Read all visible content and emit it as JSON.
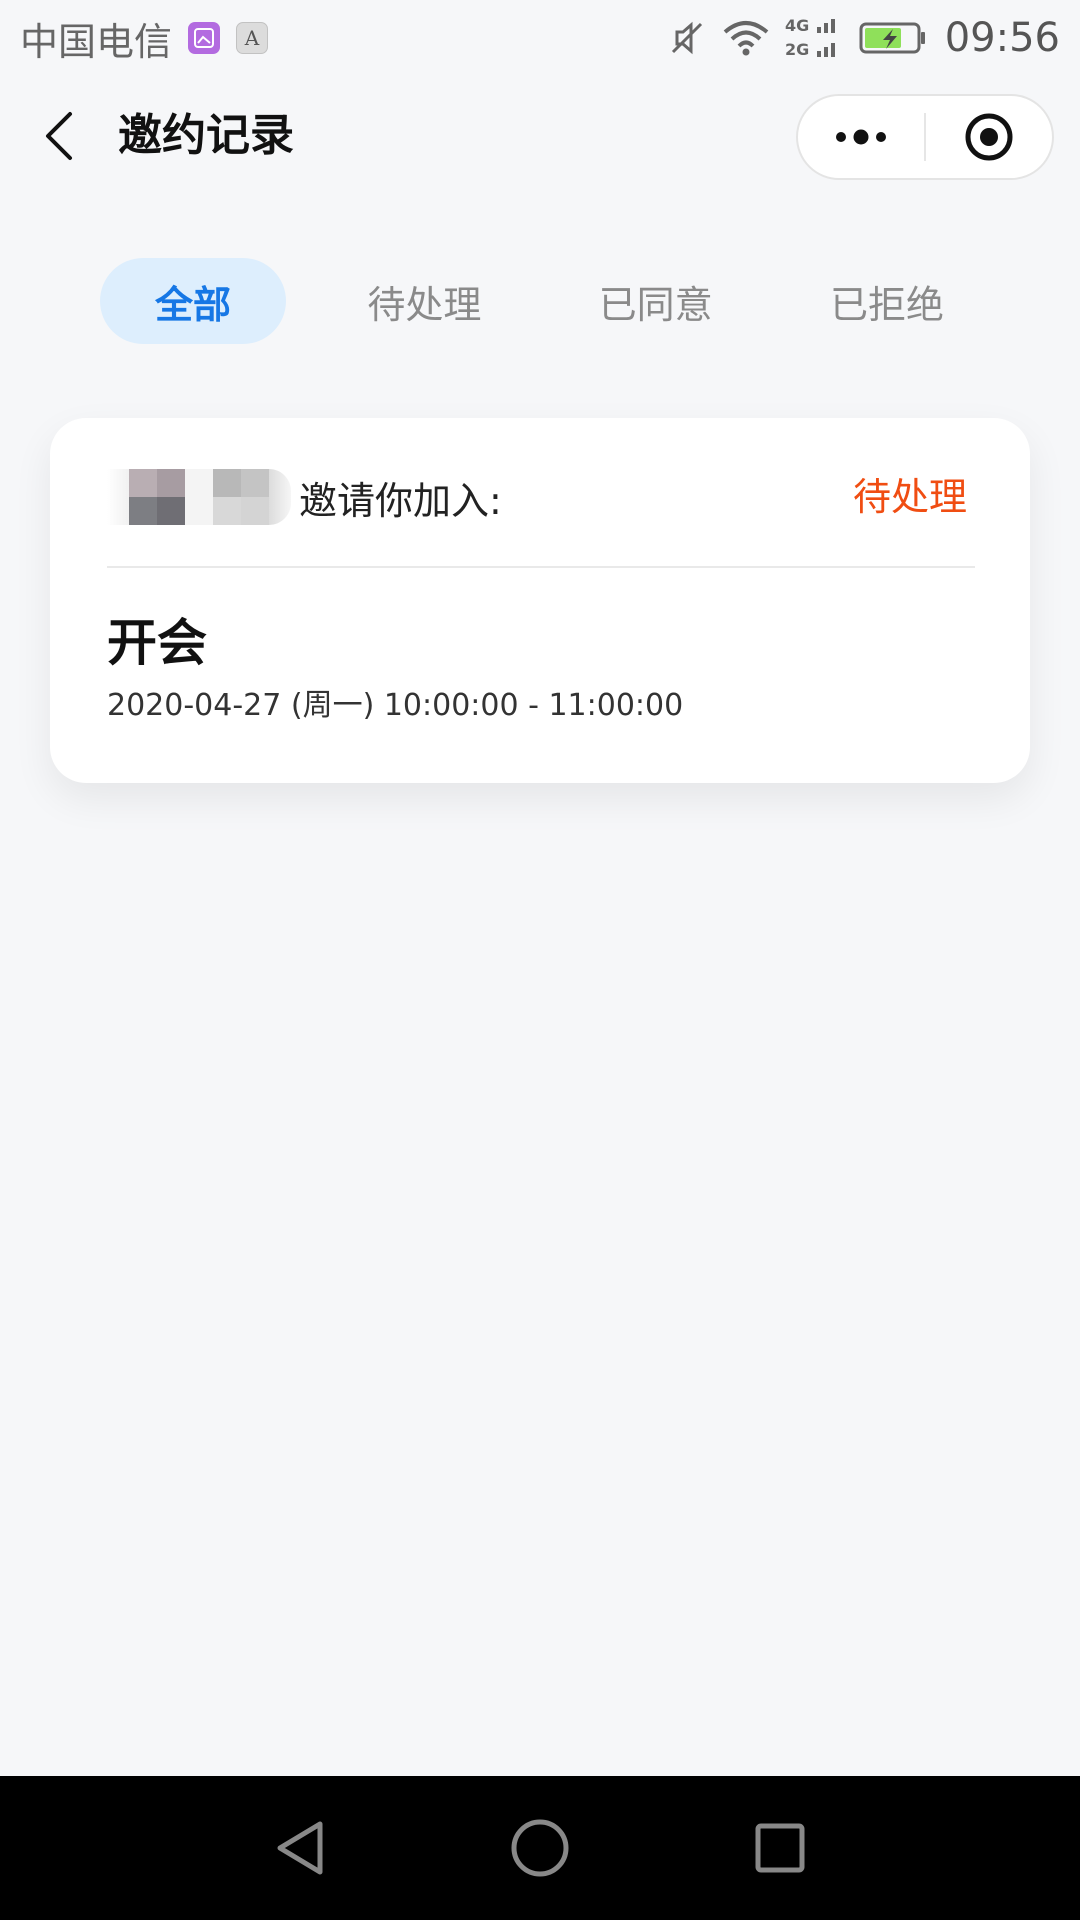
{
  "status_bar": {
    "carrier": "中国电信",
    "notification_a": "A",
    "network_top": "4G",
    "network_bottom": "2G",
    "time": "09:56"
  },
  "nav": {
    "title": "邀约记录"
  },
  "tabs": [
    {
      "label": "全部",
      "active": true
    },
    {
      "label": "待处理",
      "active": false
    },
    {
      "label": "已同意",
      "active": false
    },
    {
      "label": "已拒绝",
      "active": false
    }
  ],
  "invitation": {
    "invite_text": "邀请你加入:",
    "status": "待处理",
    "event_title": "开会",
    "event_time": "2020-04-27 (周一) 10:00:00 - 11:00:00"
  },
  "colors": {
    "accent_blue": "#1677e5",
    "active_tab_bg": "#ddeefd",
    "status_orange": "#f04d12",
    "page_bg": "#f6f7f9"
  },
  "icons": {
    "back": "chevron-left-icon",
    "more": "more-dots-icon",
    "close": "target-circle-icon",
    "system_back": "triangle-back-icon",
    "system_home": "circle-home-icon",
    "system_recents": "square-recents-icon"
  }
}
